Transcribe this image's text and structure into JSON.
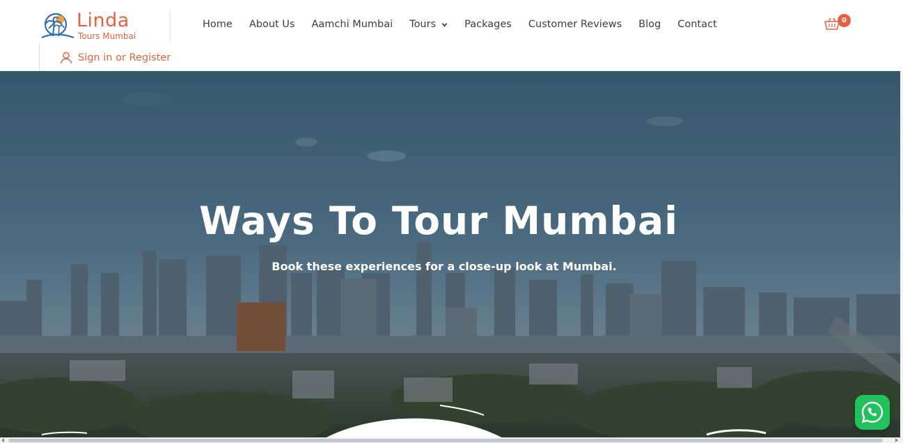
{
  "brand": {
    "title": "Linda",
    "subtitle": "Tours Mumbai",
    "accent_color": "#e2633f"
  },
  "nav": {
    "items": [
      {
        "label": "Home",
        "has_dropdown": false
      },
      {
        "label": "About Us",
        "has_dropdown": false
      },
      {
        "label": "Aamchi Mumbai",
        "has_dropdown": false
      },
      {
        "label": "Tours",
        "has_dropdown": true
      },
      {
        "label": "Packages",
        "has_dropdown": false
      },
      {
        "label": "Customer Reviews",
        "has_dropdown": false
      },
      {
        "label": "Blog",
        "has_dropdown": false
      },
      {
        "label": "Contact",
        "has_dropdown": false
      }
    ]
  },
  "cart": {
    "icon": "basket-icon",
    "count": "0"
  },
  "account": {
    "icon": "user-icon",
    "label": "Sign in or Register"
  },
  "hero": {
    "title": "Ways To Tour Mumbai",
    "subtitle": "Book these experiences for a close-up look at Mumbai."
  },
  "whatsapp": {
    "icon": "whatsapp-icon",
    "color": "#22c15e"
  }
}
